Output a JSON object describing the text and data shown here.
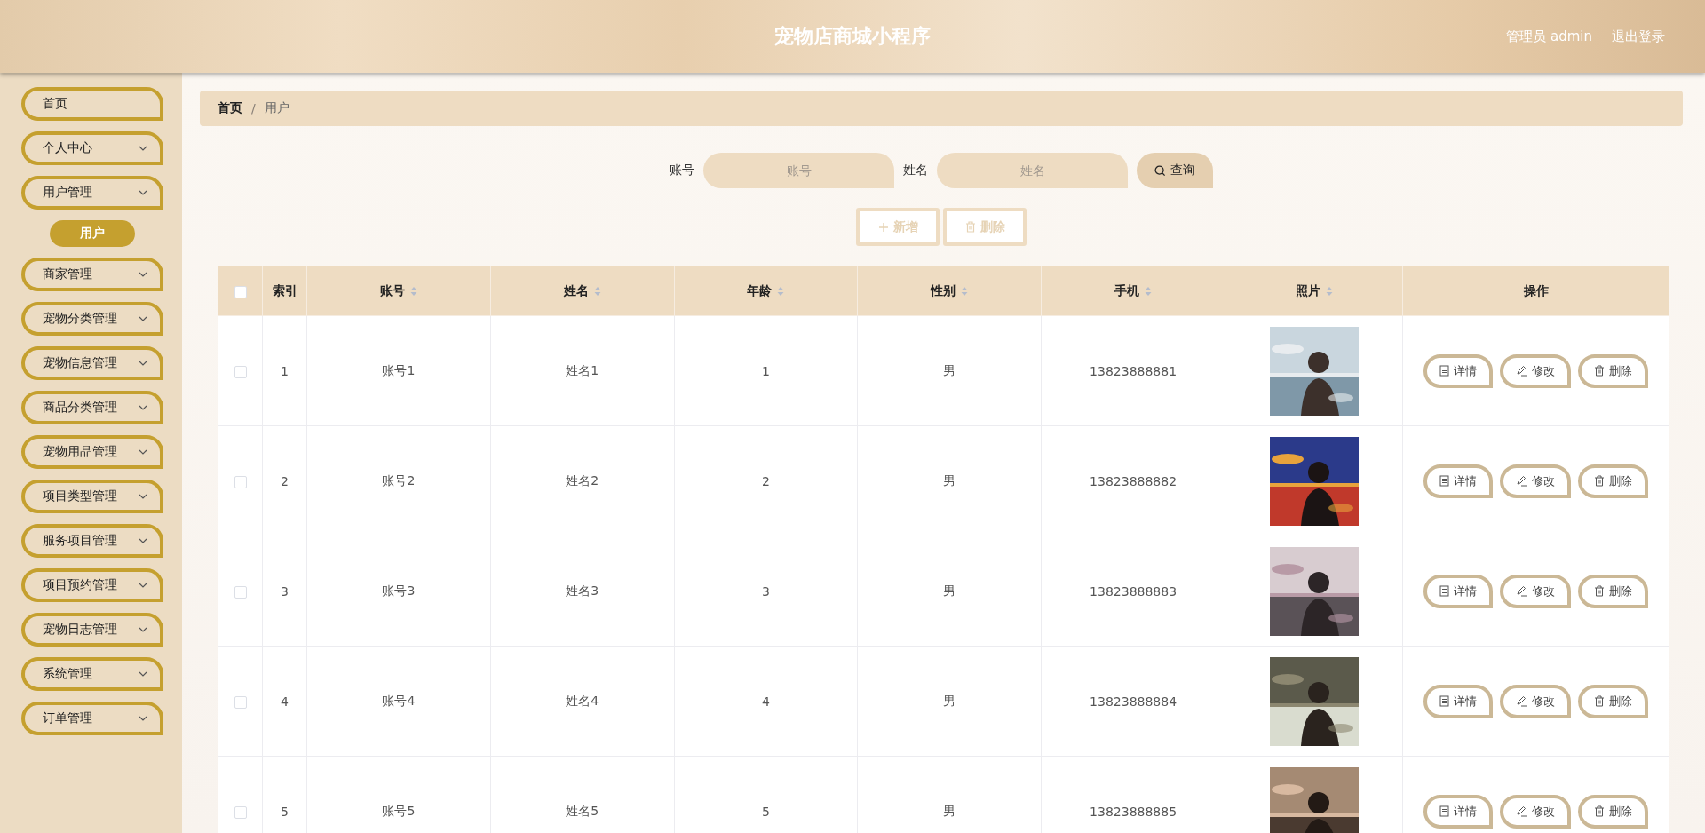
{
  "header": {
    "title": "宠物店商城小程序",
    "user": "管理员 admin",
    "logout": "退出登录"
  },
  "sidebar": {
    "items": [
      {
        "label": "首页",
        "kind": "link"
      },
      {
        "label": "个人中心",
        "kind": "menu"
      },
      {
        "label": "用户管理",
        "kind": "menu",
        "children": [
          {
            "label": "用户",
            "selected": true
          }
        ]
      },
      {
        "label": "商家管理",
        "kind": "menu"
      },
      {
        "label": "宠物分类管理",
        "kind": "menu"
      },
      {
        "label": "宠物信息管理",
        "kind": "menu"
      },
      {
        "label": "商品分类管理",
        "kind": "menu"
      },
      {
        "label": "宠物用品管理",
        "kind": "menu"
      },
      {
        "label": "项目类型管理",
        "kind": "menu"
      },
      {
        "label": "服务项目管理",
        "kind": "menu"
      },
      {
        "label": "项目预约管理",
        "kind": "menu"
      },
      {
        "label": "宠物日志管理",
        "kind": "menu"
      },
      {
        "label": "系统管理",
        "kind": "menu"
      },
      {
        "label": "订单管理",
        "kind": "menu"
      }
    ]
  },
  "breadcrumb": {
    "items": [
      "首页",
      "用户"
    ],
    "separator": "/"
  },
  "search": {
    "fields": [
      {
        "label": "账号",
        "placeholder": "账号"
      },
      {
        "label": "姓名",
        "placeholder": "姓名"
      }
    ],
    "button": "查询"
  },
  "actions": [
    {
      "label": "新增",
      "kind": "add"
    },
    {
      "label": "删除",
      "kind": "delete"
    }
  ],
  "table": {
    "select_all_checked": false,
    "columns": [
      {
        "label": "索引",
        "sortable": false
      },
      {
        "label": "账号",
        "sortable": true
      },
      {
        "label": "姓名",
        "sortable": true
      },
      {
        "label": "年龄",
        "sortable": true
      },
      {
        "label": "性别",
        "sortable": true
      },
      {
        "label": "手机",
        "sortable": true
      },
      {
        "label": "照片",
        "sortable": true
      },
      {
        "label": "操作",
        "sortable": false
      }
    ],
    "rows": [
      {
        "checked": false,
        "cells": [
          "1",
          "账号1",
          "姓名1",
          "1",
          "男",
          "13823888881"
        ],
        "buttons": [
          {
            "label": "详情",
            "kind": "detail"
          },
          {
            "label": "修改",
            "kind": "edit"
          },
          {
            "label": "删除",
            "kind": "delete"
          }
        ]
      },
      {
        "checked": false,
        "cells": [
          "2",
          "账号2",
          "姓名2",
          "2",
          "男",
          "13823888882"
        ],
        "buttons": [
          {
            "label": "详情",
            "kind": "detail"
          },
          {
            "label": "修改",
            "kind": "edit"
          },
          {
            "label": "删除",
            "kind": "delete"
          }
        ]
      },
      {
        "checked": false,
        "cells": [
          "3",
          "账号3",
          "姓名3",
          "3",
          "男",
          "13823888883"
        ],
        "buttons": [
          {
            "label": "详情",
            "kind": "detail"
          },
          {
            "label": "修改",
            "kind": "edit"
          },
          {
            "label": "删除",
            "kind": "delete"
          }
        ]
      },
      {
        "checked": false,
        "cells": [
          "4",
          "账号4",
          "姓名4",
          "4",
          "男",
          "13823888884"
        ],
        "buttons": [
          {
            "label": "详情",
            "kind": "detail"
          },
          {
            "label": "修改",
            "kind": "edit"
          },
          {
            "label": "删除",
            "kind": "delete"
          }
        ]
      },
      {
        "checked": false,
        "cells": [
          "5",
          "账号5",
          "姓名5",
          "5",
          "男",
          "13823888885"
        ],
        "buttons": [
          {
            "label": "详情",
            "kind": "detail"
          },
          {
            "label": "修改",
            "kind": "edit"
          },
          {
            "label": "删除",
            "kind": "delete"
          }
        ]
      }
    ]
  }
}
